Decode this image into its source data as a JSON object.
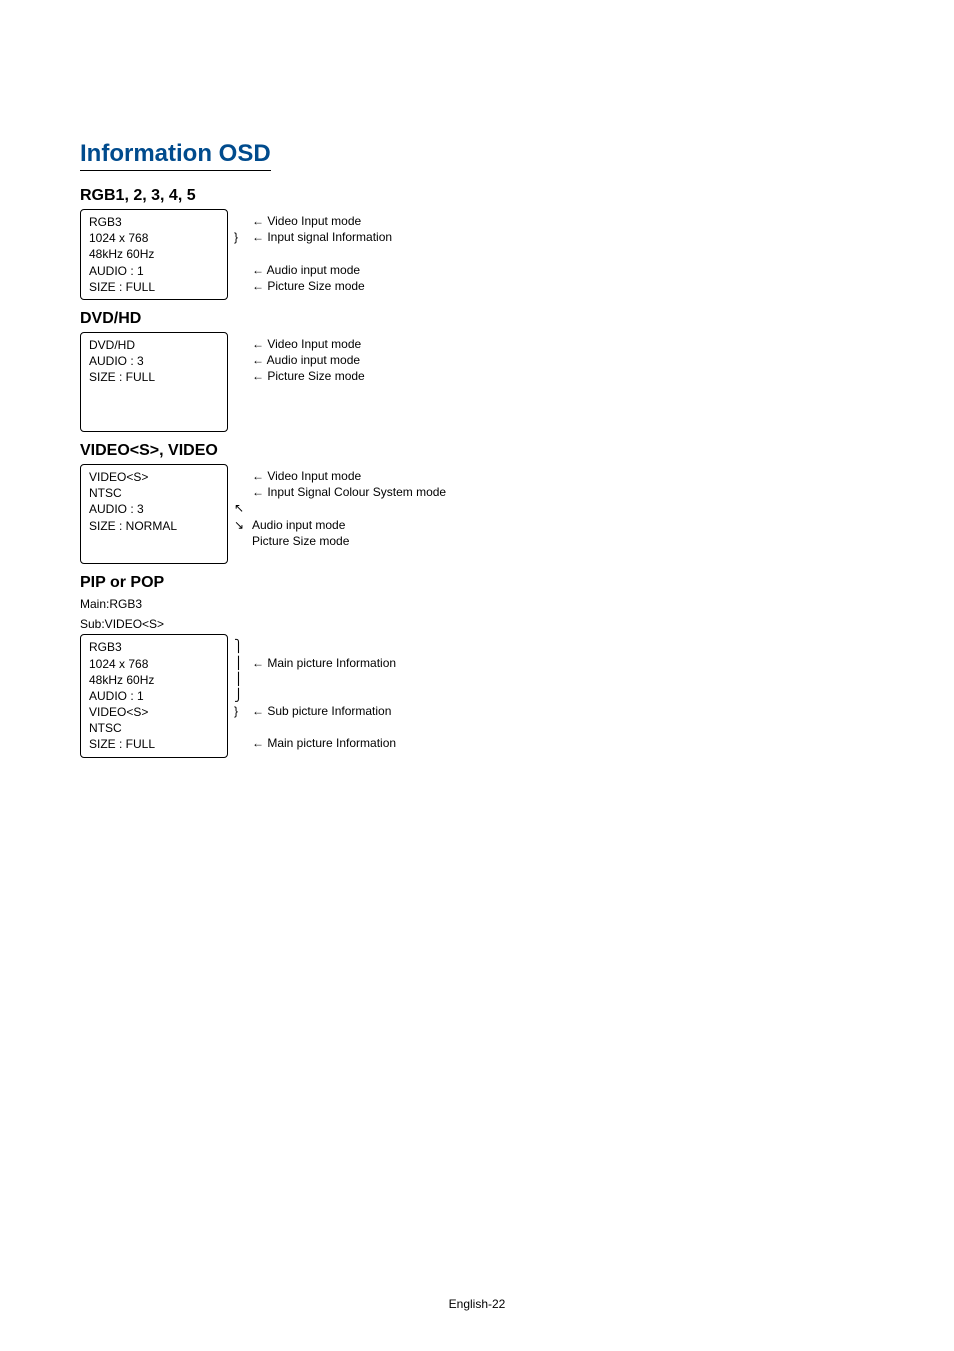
{
  "title": "Information OSD",
  "sections": [
    {
      "title": "RGB1, 2, 3, 4, 5",
      "box_lines": [
        "RGB3",
        "1024 x 768",
        "48kHz  60Hz",
        "AUDIO : 1",
        "SIZE : FULL"
      ],
      "brace_lines": [
        "",
        "}",
        "",
        "",
        ""
      ],
      "labels": [
        "←  Video Input mode",
        "←  Input signal Information",
        "",
        "←  Audio input mode",
        "←  Picture Size mode"
      ]
    },
    {
      "title": "DVD/HD",
      "box_lines": [
        "DVD/HD",
        "AUDIO : 3",
        "SIZE : FULL"
      ],
      "brace_lines": [
        "",
        "",
        ""
      ],
      "labels": [
        "←  Video Input mode",
        "←  Audio input mode",
        "←  Picture Size mode"
      ],
      "tall": true
    },
    {
      "title": "VIDEO<S>, VIDEO",
      "box_lines": [
        "VIDEO<S>",
        "NTSC",
        "AUDIO : 3",
        "SIZE : NORMAL"
      ],
      "brace_lines": [
        "",
        "",
        "↖",
        "↘"
      ],
      "labels": [
        "← Video Input mode",
        "← Input Signal Colour System mode",
        "",
        "  Audio input mode",
        "  Picture Size mode"
      ],
      "tall": true,
      "tight": true
    },
    {
      "title": "PIP or POP",
      "pre_notes": [
        "Main:RGB3",
        "Sub:VIDEO<S>"
      ],
      "box_lines": [
        "RGB3",
        "1024 x 768",
        "48kHz  60Hz",
        "AUDIO : 1",
        "VIDEO<S>",
        "NTSC",
        "SIZE : FULL"
      ],
      "brace_lines": [
        "⎫",
        "⎪",
        "⎪",
        "⎭",
        "}",
        "",
        ""
      ],
      "labels": [
        "",
        "←  Main picture Information",
        "",
        "",
        "←  Sub picture Information",
        "",
        "←  Main picture Information"
      ]
    }
  ],
  "footer": "English-22"
}
